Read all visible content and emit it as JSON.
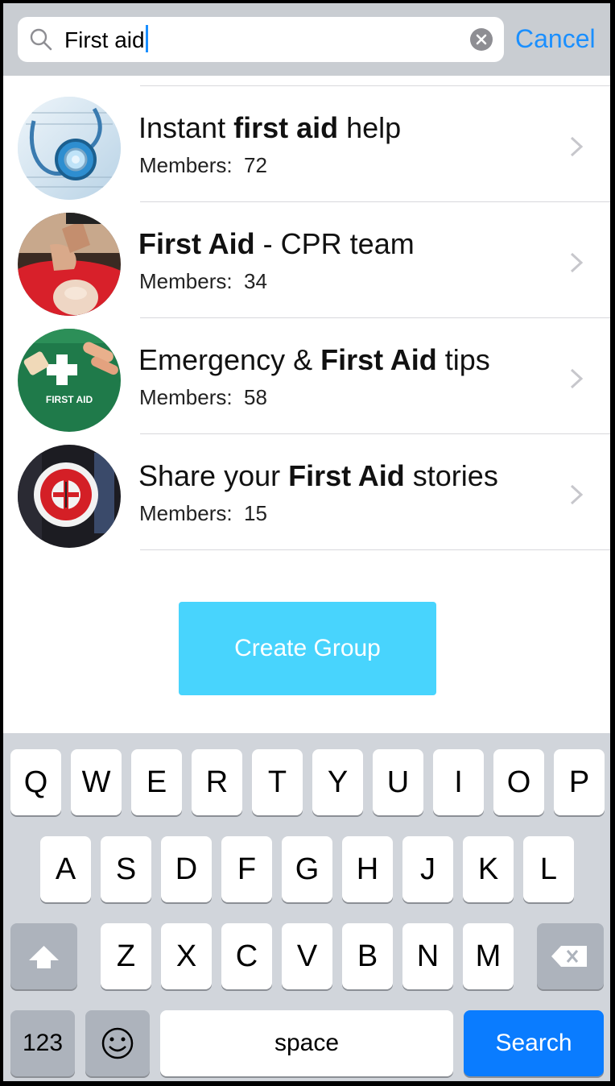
{
  "search": {
    "query": "First aid",
    "cancel_label": "Cancel"
  },
  "groups": [
    {
      "title_before": "Instant ",
      "title_bold": "first aid",
      "title_after": " help",
      "members_label": "Members:  72"
    },
    {
      "title_before": "",
      "title_bold": "First Aid",
      "title_after": " - CPR team",
      "members_label": "Members:  34"
    },
    {
      "title_before": "Emergency & ",
      "title_bold": "First Aid",
      "title_after": " tips",
      "members_label": "Members:  58"
    },
    {
      "title_before": "Share your ",
      "title_bold": "First Aid",
      "title_after": " stories",
      "members_label": "Members:  15"
    }
  ],
  "avatar_text": {
    "kit": "FIRST AID"
  },
  "create_group_label": "Create Group",
  "keyboard": {
    "row1": [
      "Q",
      "W",
      "E",
      "R",
      "T",
      "Y",
      "U",
      "I",
      "O",
      "P"
    ],
    "row2": [
      "A",
      "S",
      "D",
      "F",
      "G",
      "H",
      "J",
      "K",
      "L"
    ],
    "row3": [
      "Z",
      "X",
      "C",
      "V",
      "B",
      "N",
      "M"
    ],
    "numbers_label": "123",
    "space_label": "space",
    "search_label": "Search",
    "shift_icon": "shift-arrow-icon",
    "delete_icon": "backspace-icon",
    "emoji_icon": "smiley-icon"
  },
  "colors": {
    "accent": "#1a8fff",
    "create_button": "#48d4fd",
    "search_key": "#0a7cff"
  }
}
